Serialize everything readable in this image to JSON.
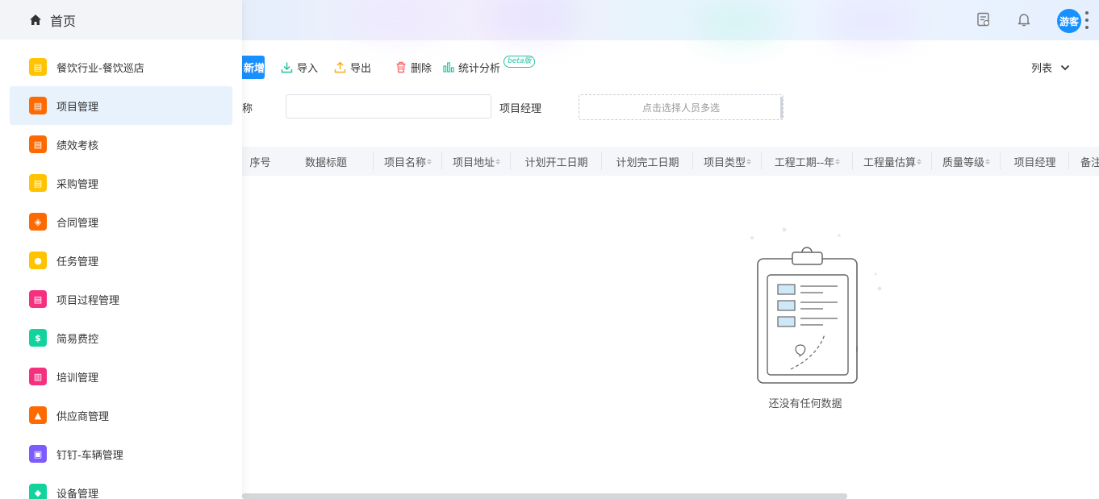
{
  "sidebar": {
    "home_label": "首页",
    "items": [
      {
        "label": "餐饮行业-餐饮巡店",
        "icon": "doc-icon",
        "color": "#ffc300",
        "glyph": "▤"
      },
      {
        "label": "项目管理",
        "icon": "doc-icon",
        "color": "#ff6a00",
        "glyph": "▤"
      },
      {
        "label": "绩效考核",
        "icon": "doc-icon",
        "color": "#ff6a00",
        "glyph": "▤"
      },
      {
        "label": "采购管理",
        "icon": "doc-icon",
        "color": "#ffc300",
        "glyph": "▤"
      },
      {
        "label": "合同管理",
        "icon": "layers-icon",
        "color": "#ff6a00",
        "glyph": "◈"
      },
      {
        "label": "任务管理",
        "icon": "person-icon",
        "color": "#ffc300",
        "glyph": "●"
      },
      {
        "label": "项目过程管理",
        "icon": "doc-icon",
        "color": "#f5317f",
        "glyph": "▤"
      },
      {
        "label": "简易费控",
        "icon": "money-bag-icon",
        "color": "#12d39d",
        "glyph": "$"
      },
      {
        "label": "培训管理",
        "icon": "file-icon",
        "color": "#f5317f",
        "glyph": "▥"
      },
      {
        "label": "供应商管理",
        "icon": "building-icon",
        "color": "#ff6a00",
        "glyph": "▲"
      },
      {
        "label": "钉钉-车辆管理",
        "icon": "box-icon",
        "color": "#7c5cff",
        "glyph": "▣"
      },
      {
        "label": "设备管理",
        "icon": "device-icon",
        "color": "#12d39d",
        "glyph": "◆"
      }
    ],
    "active_index": 1
  },
  "header": {
    "avatar_label": "游客",
    "icons": [
      "report-icon",
      "bell-icon",
      "more-vertical-icon"
    ]
  },
  "toolbar": {
    "add_label": "新增",
    "import_label": "导入",
    "export_label": "导出",
    "delete_label": "删除",
    "stats_label": "统计分析",
    "beta_label": "beta版",
    "view_label": "列表"
  },
  "filters": {
    "name_label": "称",
    "manager_label": "项目经理",
    "manager_placeholder": "点击选择人员多选"
  },
  "table": {
    "columns": [
      {
        "label": "序号",
        "sortable": false
      },
      {
        "label": "数据标题",
        "sortable": false
      },
      {
        "label": "项目名称",
        "sortable": true
      },
      {
        "label": "项目地址",
        "sortable": true
      },
      {
        "label": "计划开工日期",
        "sortable": true
      },
      {
        "label": "计划完工日期",
        "sortable": true
      },
      {
        "label": "项目类型",
        "sortable": true
      },
      {
        "label": "工程工期--年",
        "sortable": true
      },
      {
        "label": "工程量估算",
        "sortable": true
      },
      {
        "label": "质量等级",
        "sortable": true
      },
      {
        "label": "项目经理",
        "sortable": false
      },
      {
        "label": "备注",
        "sortable": false
      }
    ],
    "empty_text": "还没有任何数据"
  },
  "colors": {
    "primary": "#1890ff",
    "import": "#25c39f",
    "export": "#faad14",
    "delete": "#f56c6c",
    "stats": "#25c39f"
  }
}
